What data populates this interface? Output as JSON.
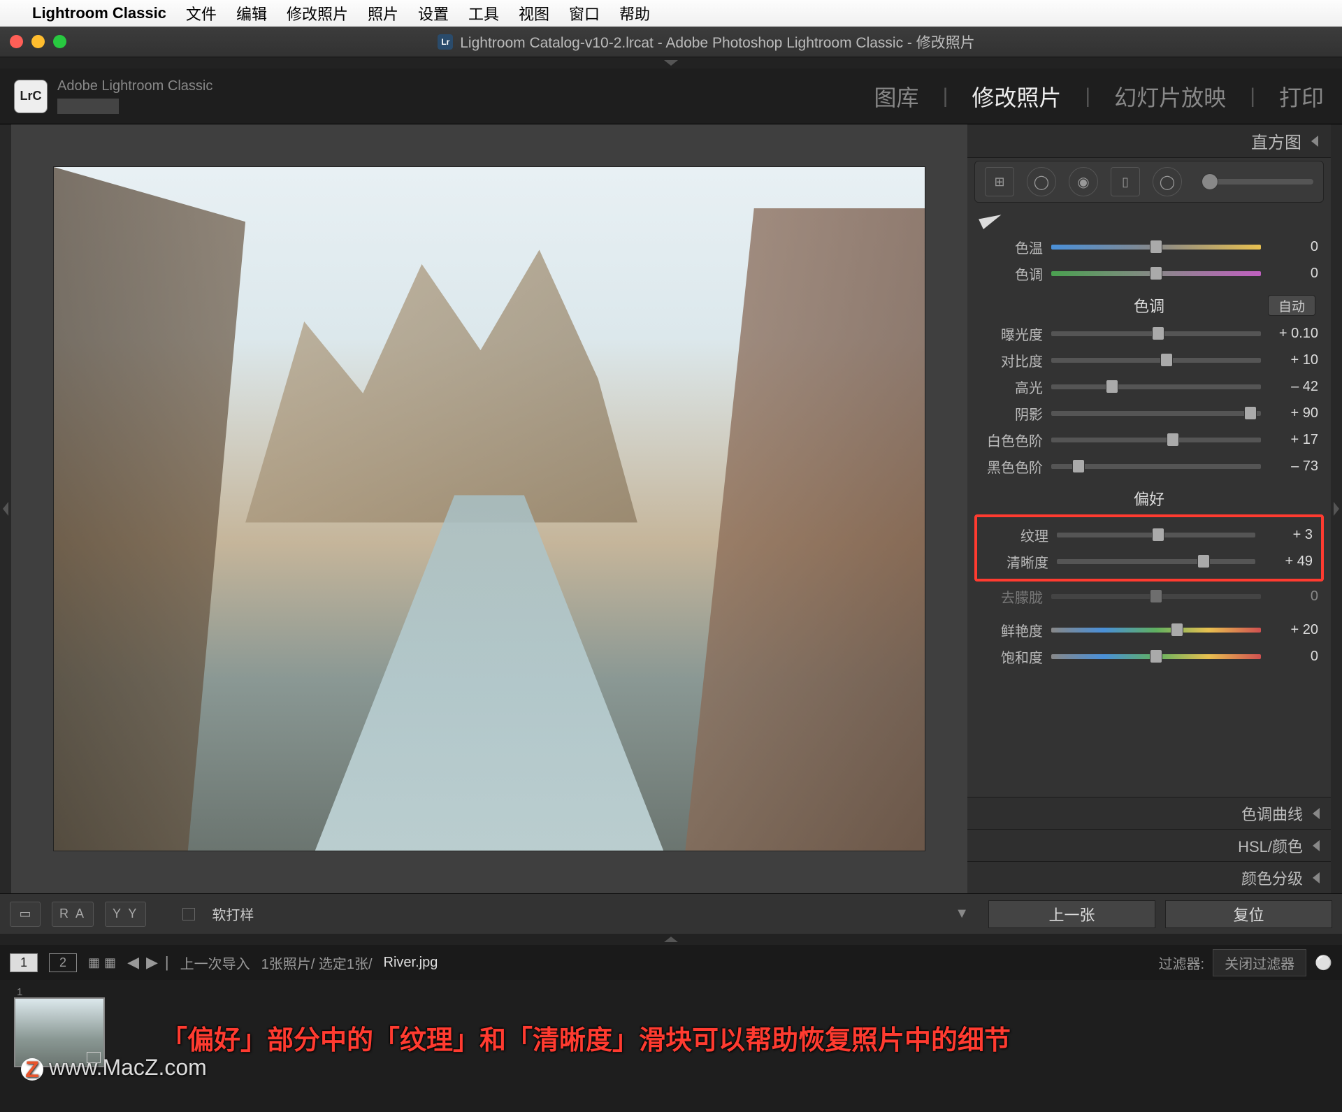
{
  "menubar": {
    "app": "Lightroom Classic",
    "items": [
      "文件",
      "编辑",
      "修改照片",
      "照片",
      "设置",
      "工具",
      "视图",
      "窗口",
      "帮助"
    ]
  },
  "window_title": "Lightroom Catalog-v10-2.lrcat - Adobe Photoshop Lightroom Classic - 修改照片",
  "header": {
    "brand": "Adobe Lightroom Classic",
    "icon": "LrC"
  },
  "modules": {
    "library": "图库",
    "develop": "修改照片",
    "slideshow": "幻灯片放映",
    "print": "打印"
  },
  "panels": {
    "histogram": "直方图",
    "wb": {
      "temp_lbl": "色温",
      "temp_val": "0",
      "tint_lbl": "色调",
      "tint_val": "0"
    },
    "tone": {
      "title": "色调",
      "auto": "自动",
      "exposure_lbl": "曝光度",
      "exposure_val": "+ 0.10",
      "contrast_lbl": "对比度",
      "contrast_val": "+ 10",
      "highlights_lbl": "高光",
      "highlights_val": "– 42",
      "shadows_lbl": "阴影",
      "shadows_val": "+ 90",
      "whites_lbl": "白色色阶",
      "whites_val": "+ 17",
      "blacks_lbl": "黑色色阶",
      "blacks_val": "– 73"
    },
    "presence": {
      "title": "偏好",
      "texture_lbl": "纹理",
      "texture_val": "+ 3",
      "clarity_lbl": "清晰度",
      "clarity_val": "+ 49",
      "dehaze_lbl": "去朦胧",
      "dehaze_val": "0",
      "vibrance_lbl": "鲜艳度",
      "vibrance_val": "+ 20",
      "saturation_lbl": "饱和度",
      "saturation_val": "0"
    },
    "tonecurve": "色调曲线",
    "hsl": "HSL/颜色",
    "colorgrade": "颜色分级"
  },
  "toolbar": {
    "softproof": "软打样",
    "prev": "上一张",
    "reset": "复位"
  },
  "filmstrip": {
    "tab1": "1",
    "tab2": "2",
    "context": "上一次导入",
    "count": "1张照片/ 选定1张/",
    "filename": "River.jpg",
    "filter_lbl": "过滤器:",
    "filter_sel": "关闭过滤器"
  },
  "annotation": "「偏好」部分中的「纹理」和「清晰度」滑块可以帮助恢复照片中的细节",
  "watermark": "www.MacZ.com"
}
